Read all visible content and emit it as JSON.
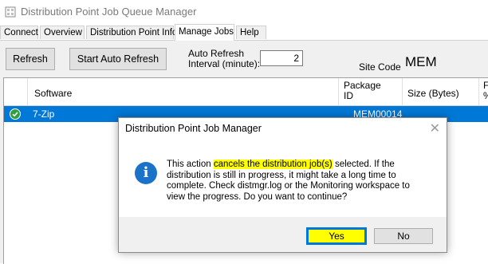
{
  "window": {
    "title": "Distribution Point Job Queue Manager",
    "icon": "app-icon"
  },
  "tabs": [
    {
      "label": "Connect"
    },
    {
      "label": "Overview"
    },
    {
      "label": "Distribution Point Info"
    },
    {
      "label": "Manage Jobs",
      "active": true
    },
    {
      "label": "Help"
    }
  ],
  "toolbar": {
    "refresh_label": "Refresh",
    "auto_refresh_label": "Start Auto Refresh",
    "interval_label_line1": "Auto Refresh",
    "interval_label_line2": "Interval (minute):",
    "interval_value": "2",
    "site_code_label": "Site Code",
    "site_code_value": "MEM"
  },
  "grid": {
    "headers": {
      "software": "Software",
      "package_id_line1": "Package",
      "package_id_line2": "ID",
      "size": "Size (Bytes)",
      "extra_line1": "F",
      "extra_line2": "%"
    },
    "rows": [
      {
        "status_icon": "check-circle-icon",
        "software": "7-Zip",
        "package_id": "MEM00014",
        "selected": true
      }
    ]
  },
  "dialog": {
    "title": "Distribution Point Job Manager",
    "icon": "info-icon",
    "message_before": "This action ",
    "message_highlight": "cancels the distribution job(s)",
    "message_after": " selected. If the distribution is still in progress, it might take a long time to complete. Check distmgr.log or the Monitoring workspace to view the progress. Do you want to continue?",
    "yes_label": "Yes",
    "no_label": "No"
  },
  "colors": {
    "selection": "#0078d7",
    "highlight": "#ffff00",
    "info_icon": "#1a73c9",
    "check_icon": "#2e9e3e"
  }
}
